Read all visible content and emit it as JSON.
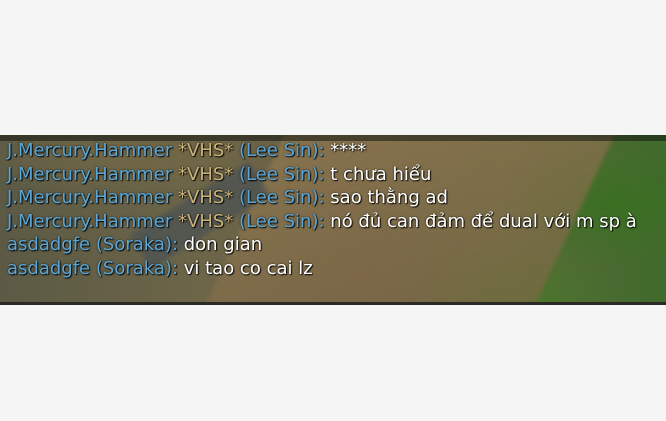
{
  "chat": {
    "lines": [
      {
        "name": "J.Mercury.Hammer",
        "tag": "*VHS*",
        "champion": "(Lee Sin)",
        "sep": ": ",
        "message": "****"
      },
      {
        "name": "J.Mercury.Hammer",
        "tag": "*VHS*",
        "champion": "(Lee Sin)",
        "sep": ": ",
        "message": "t chưa hiểu"
      },
      {
        "name": "J.Mercury.Hammer",
        "tag": "*VHS*",
        "champion": "(Lee Sin)",
        "sep": ": ",
        "message": "sao thằng ad"
      },
      {
        "name": "J.Mercury.Hammer",
        "tag": "*VHS*",
        "champion": "(Lee Sin)",
        "sep": ": ",
        "message": "nó đủ can đảm để dual với m sp à"
      },
      {
        "name": "asdadgfe",
        "tag": "",
        "champion": "(Soraka)",
        "sep": ": ",
        "message": "don gian"
      },
      {
        "name": "asdadgfe",
        "tag": "",
        "champion": "(Soraka)",
        "sep": ": ",
        "message": "vi tao co cai lz"
      }
    ]
  },
  "colors": {
    "player_name": "#5aa6d6",
    "tag": "#cbb27a",
    "message": "#ffffff",
    "background": "#f5f5f5"
  }
}
